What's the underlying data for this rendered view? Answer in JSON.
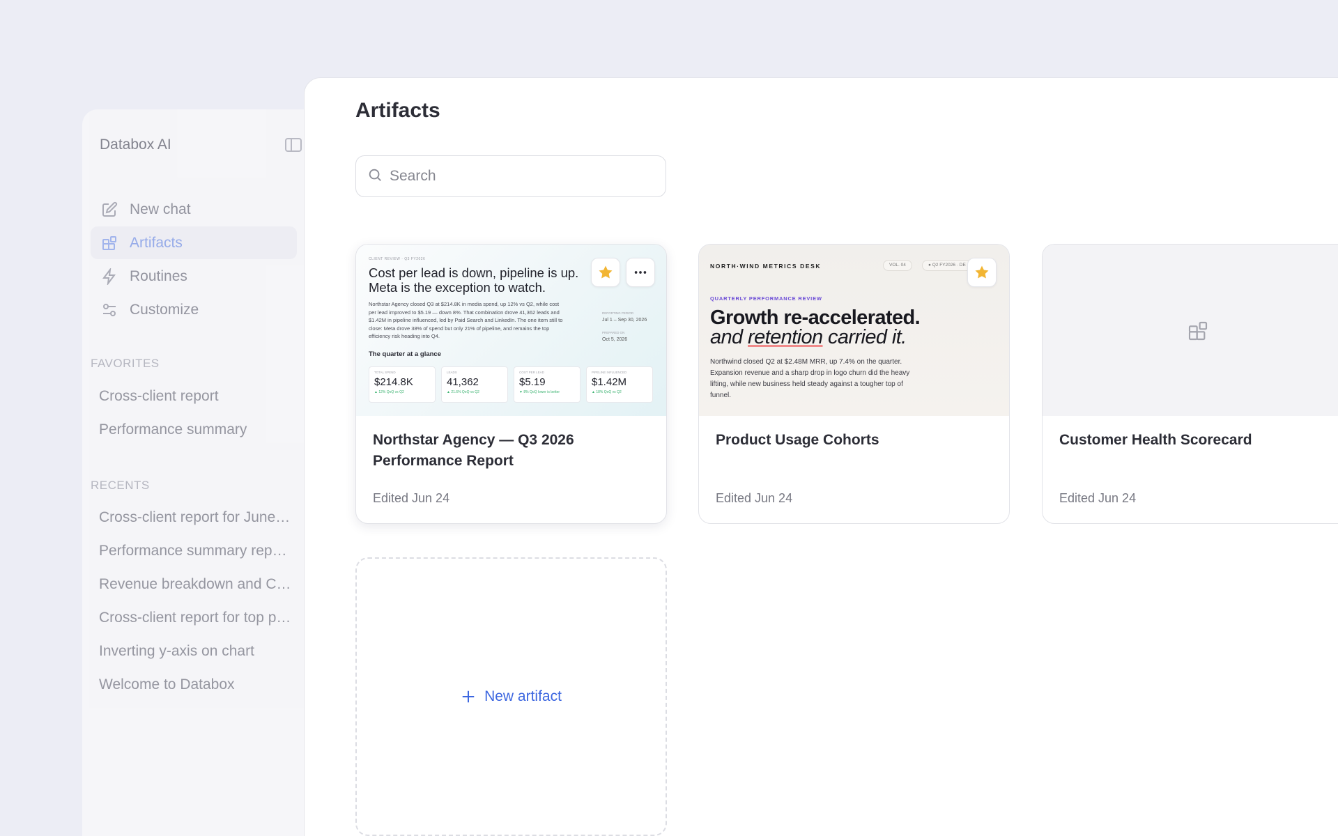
{
  "sidebar": {
    "title": "Databox AI",
    "nav": [
      {
        "label": "New chat",
        "icon": "edit-icon"
      },
      {
        "label": "Artifacts",
        "icon": "artifacts-icon",
        "active": true
      },
      {
        "label": "Routines",
        "icon": "lightning-icon"
      },
      {
        "label": "Customize",
        "icon": "sliders-icon"
      }
    ],
    "favorites_label": "FAVORITES",
    "favorites": [
      "Cross-client report",
      "Performance summary"
    ],
    "recents_label": "RECENTS",
    "recents": [
      "Cross-client report for June…",
      "Performance summary rep…",
      "Revenue breakdown and C…",
      "Cross-client report for top p…",
      "Inverting y-axis on chart",
      "Welcome to Databox"
    ]
  },
  "main": {
    "title": "Artifacts",
    "search_placeholder": "Search",
    "new_artifact_label": "New artifact",
    "cards": [
      {
        "title": "Northstar Agency — Q3 2026 Performance Report",
        "edited": "Edited Jun 24",
        "favorite": true,
        "preview": {
          "kicker": "CLIENT REVIEW · Q3 FY2026",
          "headline": "Cost per lead is down, pipeline is up. Meta is the exception to watch.",
          "body": "Northstar Agency closed Q3 at $214.8K in media spend, up 12% vs Q2, while cost per lead improved to $5.19 — down 8%. That combination drove 41,362 leads and $1.42M in pipeline influenced, led by Paid Search and LinkedIn. The one item still to close: Meta drove 38% of spend but only 21% of pipeline, and remains the top efficiency risk heading into Q4.",
          "period_label": "REPORTING PERIOD",
          "period": "Jul 1 – Sep 30, 2026",
          "prepared_label": "PREPARED ON",
          "prepared": "Oct 5, 2026",
          "glance": "The quarter at a glance",
          "tiles": [
            {
              "label": "TOTAL SPEND",
              "value": "$214.8K",
              "delta": "▲ 12% QoQ  vs Q2"
            },
            {
              "label": "LEADS",
              "value": "41,362",
              "delta": "▲ 21.6% QoQ  vs Q2"
            },
            {
              "label": "COST PER LEAD",
              "value": "$5.19",
              "delta": "▼ 8% QoQ  lower is better"
            },
            {
              "label": "PIPELINE INFLUENCED",
              "value": "$1.42M",
              "delta": "▲ 18% QoQ  vs Q2"
            }
          ]
        }
      },
      {
        "title": "Product Usage Cohorts",
        "edited": "Edited Jun 24",
        "favorite": true,
        "preview": {
          "brand": "NORTH·WIND METRICS DESK",
          "pill1": "VOL. 04",
          "pill2": "● Q2 FY2026 · DE",
          "kicker": "QUARTERLY PERFORMANCE REVIEW",
          "headline1": "Growth re-accelerated.",
          "headline2_pre": "and ",
          "headline2_u": "retention",
          "headline2_post": " carried it.",
          "body": "Northwind closed Q2 at $2.48M MRR, up 7.4% on the quarter. Expansion revenue and a sharp drop in logo churn did the heavy lifting, while new business held steady against a tougher top of funnel."
        }
      },
      {
        "title": "Customer Health Scorecard",
        "edited": "Edited Jun 24",
        "favorite": false
      }
    ]
  },
  "colors": {
    "accent": "#3d67e0",
    "star": "#f2b533",
    "active_nav": "#8fa6e8"
  }
}
